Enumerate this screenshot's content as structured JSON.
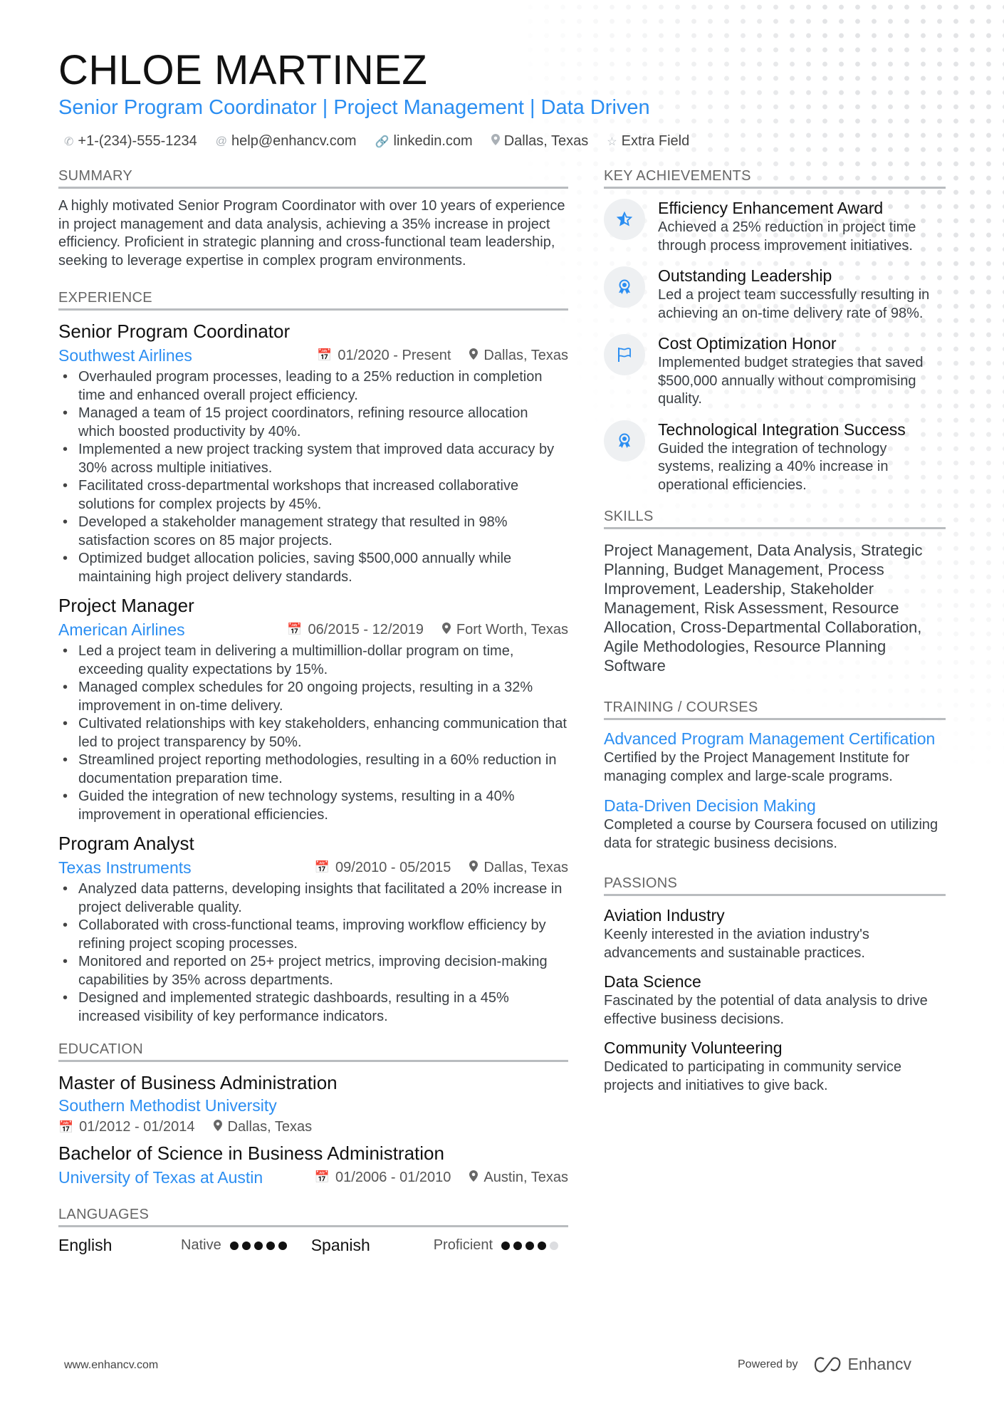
{
  "header": {
    "name": "CHLOE MARTINEZ",
    "headline": "Senior Program Coordinator | Project Management | Data Driven",
    "contacts": [
      {
        "icon": "phone-icon",
        "text": "+1-(234)-555-1234"
      },
      {
        "icon": "at-icon",
        "text": "help@enhancv.com"
      },
      {
        "icon": "link-icon",
        "text": "linkedin.com"
      },
      {
        "icon": "location-pin-icon",
        "text": "Dallas, Texas"
      },
      {
        "icon": "star-icon",
        "text": "Extra Field"
      }
    ]
  },
  "summary": {
    "heading": "SUMMARY",
    "text": "A highly motivated Senior Program Coordinator with over 10 years of experience in project management and data analysis, achieving a 35% increase in project efficiency. Proficient in strategic planning and cross-functional team leadership, seeking to leverage expertise in complex program environments."
  },
  "experience": {
    "heading": "EXPERIENCE",
    "jobs": [
      {
        "title": "Senior Program Coordinator",
        "company": "Southwest Airlines",
        "dates": "01/2020 - Present",
        "location": "Dallas, Texas",
        "bullets": [
          "Overhauled program processes, leading to a 25% reduction in completion time and enhanced overall project efficiency.",
          "Managed a team of 15 project coordinators, refining resource allocation which boosted productivity by 40%.",
          "Implemented a new project tracking system that improved data accuracy by 30% across multiple initiatives.",
          "Facilitated cross-departmental workshops that increased collaborative solutions for complex projects by 45%.",
          "Developed a stakeholder management strategy that resulted in 98% satisfaction scores on 85 major projects.",
          "Optimized budget allocation policies, saving $500,000 annually while maintaining high project delivery standards."
        ]
      },
      {
        "title": "Project Manager",
        "company": "American Airlines",
        "dates": "06/2015 - 12/2019",
        "location": "Fort Worth, Texas",
        "bullets": [
          "Led a project team in delivering a multimillion-dollar program on time, exceeding quality expectations by 15%.",
          "Managed complex schedules for 20 ongoing projects, resulting in a 32% improvement in on-time delivery.",
          "Cultivated relationships with key stakeholders, enhancing communication that led to project transparency by 50%.",
          "Streamlined project reporting methodologies, resulting in a 60% reduction in documentation preparation time.",
          "Guided the integration of new technology systems, resulting in a 40% improvement in operational efficiencies."
        ]
      },
      {
        "title": "Program Analyst",
        "company": "Texas Instruments",
        "dates": "09/2010 - 05/2015",
        "location": "Dallas, Texas",
        "bullets": [
          "Analyzed data patterns, developing insights that facilitated a 20% increase in project deliverable quality.",
          "Collaborated with cross-functional teams, improving workflow efficiency by refining project scoping processes.",
          "Monitored and reported on 25+ project metrics, improving decision-making capabilities by 35% across departments.",
          "Designed and implemented strategic dashboards, resulting in a 45% increased visibility of key performance indicators."
        ]
      }
    ]
  },
  "education": {
    "heading": "EDUCATION",
    "items": [
      {
        "degree": "Master of Business Administration",
        "school": "Southern Methodist University",
        "dates": "01/2012 - 01/2014",
        "location": "Dallas, Texas"
      },
      {
        "degree": "Bachelor of Science in Business Administration",
        "school": "University of Texas at Austin",
        "dates": "01/2006 - 01/2010",
        "location": "Austin, Texas"
      }
    ]
  },
  "languages": {
    "heading": "LANGUAGES",
    "items": [
      {
        "name": "English",
        "level": "Native",
        "rating": 5,
        "max": 5
      },
      {
        "name": "Spanish",
        "level": "Proficient",
        "rating": 4,
        "max": 5
      }
    ]
  },
  "achievements": {
    "heading": "KEY ACHIEVEMENTS",
    "items": [
      {
        "icon": "star-icon",
        "title": "Efficiency Enhancement Award",
        "desc": "Achieved a 25% reduction in project time through process improvement initiatives."
      },
      {
        "icon": "award-ribbon-icon",
        "title": "Outstanding Leadership",
        "desc": "Led a project team successfully resulting in achieving an on-time delivery rate of 98%."
      },
      {
        "icon": "flag-icon",
        "title": "Cost Optimization Honor",
        "desc": "Implemented budget strategies that saved $500,000 annually without compromising quality."
      },
      {
        "icon": "award-ribbon-icon",
        "title": "Technological Integration Success",
        "desc": "Guided the integration of technology systems, realizing a 40% increase in operational efficiencies."
      }
    ]
  },
  "skills": {
    "heading": "SKILLS",
    "text": "Project Management, Data Analysis, Strategic Planning, Budget Management, Process Improvement, Leadership, Stakeholder Management, Risk Assessment, Resource Allocation, Cross-Departmental Collaboration, Agile Methodologies, Resource Planning Software"
  },
  "training": {
    "heading": "TRAINING / COURSES",
    "items": [
      {
        "title": "Advanced Program Management Certification",
        "desc": "Certified by the Project Management Institute for managing complex and large-scale programs."
      },
      {
        "title": "Data-Driven Decision Making",
        "desc": "Completed a course by Coursera focused on utilizing data for strategic business decisions."
      }
    ]
  },
  "passions": {
    "heading": "PASSIONS",
    "items": [
      {
        "title": "Aviation Industry",
        "desc": "Keenly interested in the aviation industry's advancements and sustainable practices."
      },
      {
        "title": "Data Science",
        "desc": "Fascinated by the potential of data analysis to drive effective business decisions."
      },
      {
        "title": "Community Volunteering",
        "desc": "Dedicated to participating in community service projects and initiatives to give back."
      }
    ]
  },
  "footer": {
    "website": "www.enhancv.com",
    "powered_by": "Powered by",
    "brand": "Enhancv"
  },
  "colors": {
    "accent": "#2b8ef2",
    "heading_rule": "#b9bcbf",
    "text": "#3a3f44"
  }
}
